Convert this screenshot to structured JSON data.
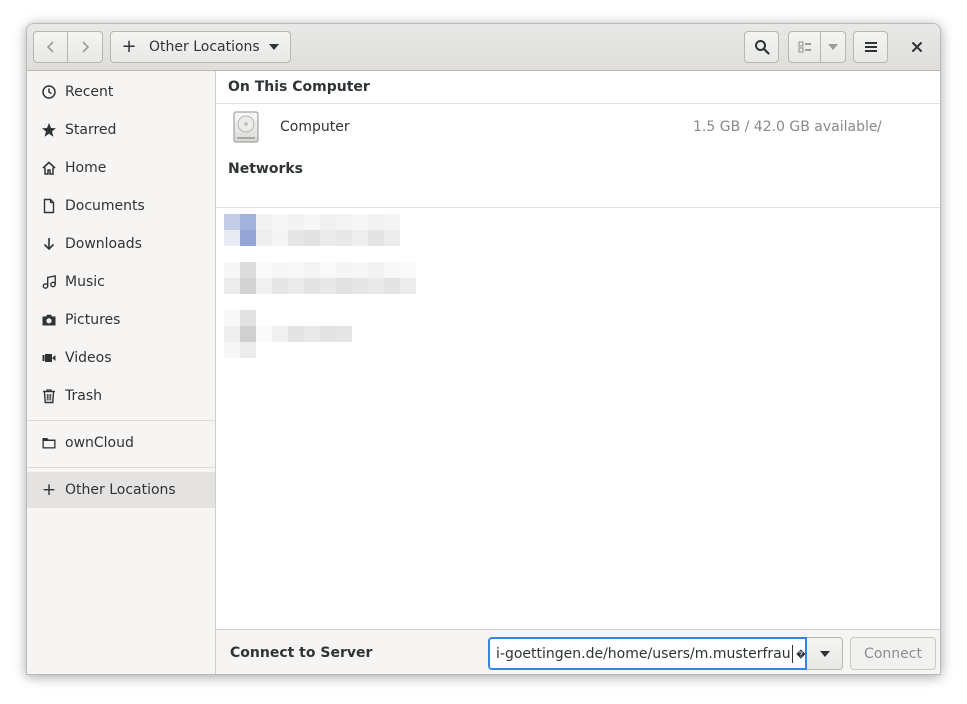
{
  "header": {
    "back_icon": "chevron-left-icon",
    "forward_icon": "chevron-right-icon",
    "path": {
      "plus": "+",
      "label": "Other Locations"
    }
  },
  "sidebar": {
    "items": [
      {
        "label": "Recent",
        "icon": "clock-icon"
      },
      {
        "label": "Starred",
        "icon": "star-icon"
      },
      {
        "label": "Home",
        "icon": "home-icon"
      },
      {
        "label": "Documents",
        "icon": "document-icon"
      },
      {
        "label": "Downloads",
        "icon": "download-icon"
      },
      {
        "label": "Music",
        "icon": "music-icon"
      },
      {
        "label": "Pictures",
        "icon": "camera-icon"
      },
      {
        "label": "Videos",
        "icon": "video-icon"
      },
      {
        "label": "Trash",
        "icon": "trash-icon"
      }
    ],
    "bookmarks": [
      {
        "label": "ownCloud",
        "icon": "folder-icon"
      }
    ],
    "other": {
      "plus": "+",
      "label": "Other Locations"
    }
  },
  "main": {
    "on_this_computer": "On This Computer",
    "computer": {
      "name": "Computer",
      "available": "1.5 GB / 42.0 GB available",
      "mount": "/"
    },
    "networks": "Networks"
  },
  "bottom": {
    "connect_label": "Connect to Server",
    "server_value": "i-goettingen.de/home/users/m.musterfrau",
    "connect_button": "Connect"
  },
  "colors": {
    "accent": "#3584e4",
    "sidebar_bg": "#f6f5f4",
    "selected_bg": "#e4e3e1"
  }
}
